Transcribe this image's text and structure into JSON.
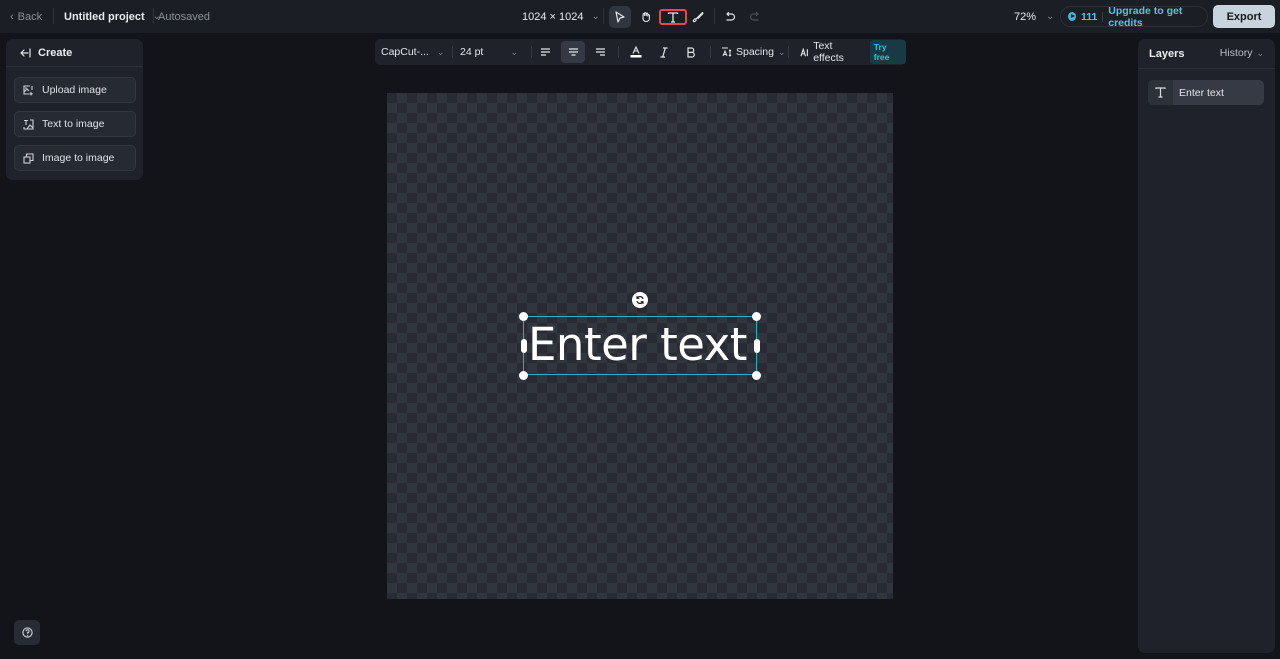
{
  "topbar": {
    "back_label": "Back",
    "project_name": "Untitled project",
    "save_status": "Autosaved",
    "canvas_size": "1024 × 1024",
    "tools": [
      {
        "name": "select",
        "icon": "pointer-icon",
        "active": true
      },
      {
        "name": "hand",
        "icon": "hand-icon",
        "active": false
      },
      {
        "name": "text",
        "icon": "text-tool-icon",
        "active": false,
        "highlighted": true
      },
      {
        "name": "brush",
        "icon": "brush-icon",
        "active": false
      }
    ],
    "undo_icon": "undo-icon",
    "redo_icon": "redo-icon",
    "zoom_level": "72%",
    "credits_count": "111",
    "upgrade_label": "Upgrade to get credits",
    "export_label": "Export"
  },
  "left_panel": {
    "title": "Create",
    "actions": [
      {
        "label": "Upload image",
        "icon": "upload-image-icon"
      },
      {
        "label": "Text to image",
        "icon": "text-to-image-icon"
      },
      {
        "label": "Image to image",
        "icon": "image-to-image-icon"
      }
    ]
  },
  "text_toolbar": {
    "font": "CapCut-...",
    "font_size": "24 pt",
    "alignment": "center",
    "spacing_label": "Spacing",
    "text_effects_label": "Text effects",
    "try_free_badge": "Try free"
  },
  "canvas": {
    "text_content": "Enter text"
  },
  "right_panel": {
    "layers_title": "Layers",
    "history_label": "History",
    "layers": [
      {
        "name": "Enter text",
        "type": "text"
      }
    ]
  },
  "colors": {
    "accent": "#22b5b8",
    "credits": "#4fc6e6",
    "highlight": "#e5484d",
    "export_bg": "#c9d3db"
  }
}
